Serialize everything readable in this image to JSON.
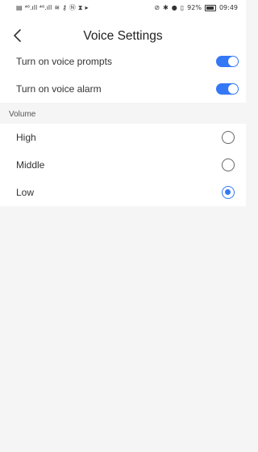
{
  "status_bar": {
    "left_text": "⁴⁶.ıll ⁴⁶.ıll",
    "battery_percent": "92%",
    "time": "09:49"
  },
  "header": {
    "title": "Voice Settings",
    "back_icon": "chevron-left-icon"
  },
  "toggles": [
    {
      "label": "Turn on voice prompts",
      "on": true
    },
    {
      "label": "Turn on voice alarm",
      "on": true
    }
  ],
  "volume": {
    "header": "Volume",
    "options": [
      {
        "label": "High",
        "selected": false
      },
      {
        "label": "Middle",
        "selected": false
      },
      {
        "label": "Low",
        "selected": true
      }
    ]
  },
  "colors": {
    "accent": "#3478f6",
    "background": "#f5f5f5",
    "card": "#ffffff"
  }
}
